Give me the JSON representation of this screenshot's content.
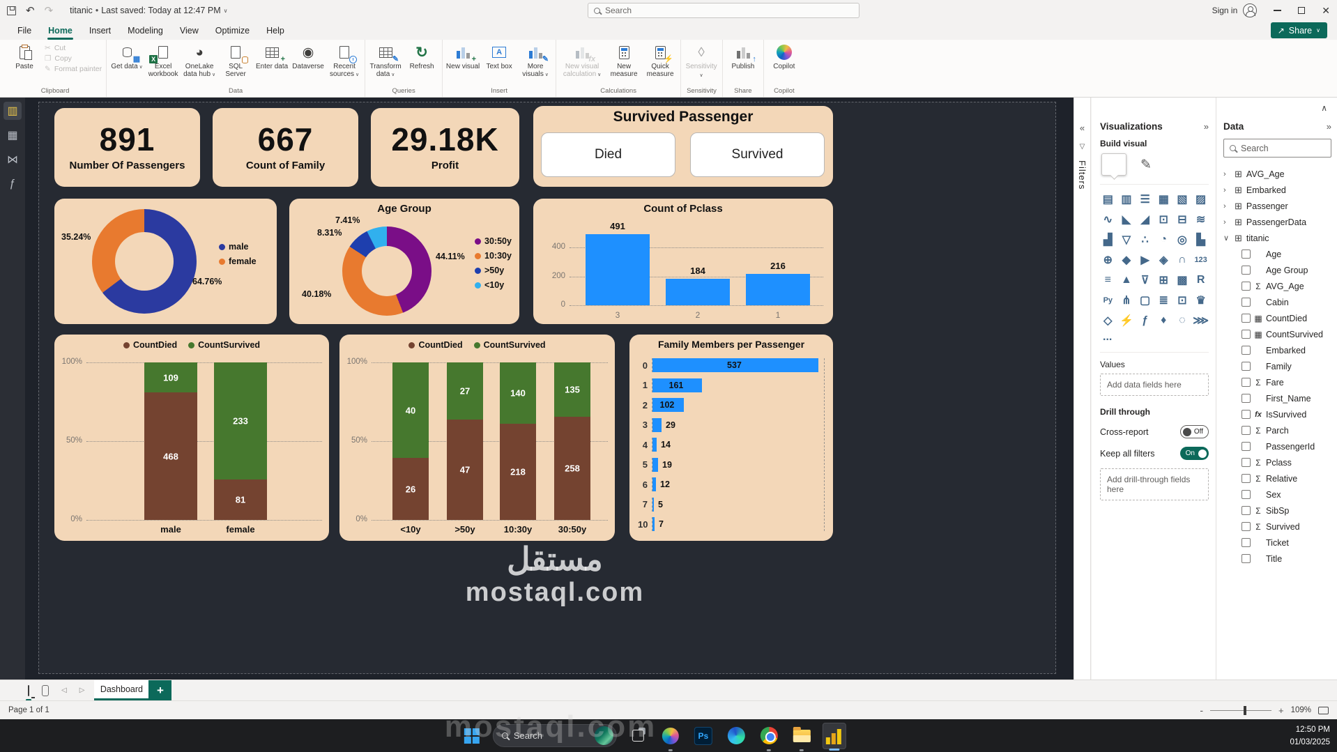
{
  "titlebar": {
    "doc_title": "titanic",
    "autosave_note": "Last saved: Today at 12:47 PM",
    "search_placeholder": "Search",
    "sign_in": "Sign in"
  },
  "menu": {
    "items": [
      "File",
      "Home",
      "Insert",
      "Modeling",
      "View",
      "Optimize",
      "Help"
    ],
    "share_label": "Share"
  },
  "ribbon": {
    "clipboard": {
      "label": "Clipboard",
      "paste": "Paste",
      "cut": "Cut",
      "copy": "Copy",
      "format_painter": "Format painter"
    },
    "data": {
      "label": "Data",
      "get_data": "Get data",
      "excel": "Excel workbook",
      "onelake": "OneLake data hub",
      "sql": "SQL Server",
      "enter": "Enter data",
      "dataverse": "Dataverse",
      "recent": "Recent sources"
    },
    "queries": {
      "label": "Queries",
      "transform": "Transform data",
      "refresh": "Refresh"
    },
    "insert": {
      "label": "Insert",
      "new_visual": "New visual",
      "text_box": "Text box",
      "more_visuals": "More visuals"
    },
    "calculations": {
      "label": "Calculations",
      "new_visual_calc": "New visual calculation",
      "new_measure": "New measure",
      "quick_measure": "Quick measure"
    },
    "sensitivity": {
      "label": "Sensitivity",
      "button": "Sensitivity"
    },
    "share": {
      "label": "Share",
      "publish": "Publish"
    },
    "copilot": {
      "label": "Copilot",
      "button": "Copilot"
    }
  },
  "cards": [
    {
      "value": "891",
      "label": "Number Of Passengers"
    },
    {
      "value": "667",
      "label": "Count of Family"
    },
    {
      "value": "29.18K",
      "label": "Profit"
    }
  ],
  "slicer": {
    "title": "Survived Passenger",
    "options": [
      "Died",
      "Survived"
    ]
  },
  "chart_data": [
    {
      "type": "donut",
      "name": "sex-distribution",
      "legend_position": "right",
      "slices": [
        {
          "label": "male",
          "value_pct": 64.76,
          "display": "64.76%",
          "color": "#2b3aa0"
        },
        {
          "label": "female",
          "value_pct": 35.24,
          "display": "35.24%",
          "color": "#e87a2f"
        }
      ]
    },
    {
      "type": "donut",
      "name": "age-group",
      "title": "Age Group",
      "legend_position": "right",
      "slices": [
        {
          "label": "30:50y",
          "value_pct": 44.11,
          "display": "44.11%",
          "color": "#7a0e87"
        },
        {
          "label": "10:30y",
          "value_pct": 40.18,
          "display": "40.18%",
          "color": "#e87a2f"
        },
        {
          "label": ">50y",
          "value_pct": 8.31,
          "display": "8.31%",
          "color": "#1e3fae"
        },
        {
          "label": "<10y",
          "value_pct": 7.41,
          "display": "7.41%",
          "color": "#31b0ee"
        }
      ]
    },
    {
      "type": "bar",
      "title": "Count of Pclass",
      "categories": [
        "3",
        "2",
        "1"
      ],
      "values": [
        491,
        184,
        216
      ],
      "yticks": [
        400,
        200,
        0
      ],
      "ymax_grid": 400,
      "grid": "dotted",
      "color": "#1e90ff"
    },
    {
      "type": "stacked100",
      "title": "",
      "categories": [
        "male",
        "female"
      ],
      "series": [
        {
          "name": "CountDied",
          "color": "#744330",
          "values": [
            468,
            81
          ]
        },
        {
          "name": "CountSurvived",
          "color": "#46782e",
          "values": [
            109,
            233
          ]
        }
      ],
      "yticks": [
        "100%",
        "50%",
        "0%"
      ],
      "legend_position": "top"
    },
    {
      "type": "stacked100",
      "title": "",
      "categories": [
        "<10y",
        ">50y",
        "10:30y",
        "30:50y"
      ],
      "series": [
        {
          "name": "CountDied",
          "color": "#744330",
          "values": [
            26,
            47,
            218,
            258
          ]
        },
        {
          "name": "CountSurvived",
          "color": "#46782e",
          "values": [
            40,
            27,
            140,
            135
          ]
        }
      ],
      "yticks": [
        "100%",
        "50%",
        "0%"
      ],
      "legend_position": "top"
    },
    {
      "type": "hbar",
      "title": "Family Members per Passenger",
      "categories": [
        "0",
        "1",
        "2",
        "3",
        "4",
        "5",
        "6",
        "7",
        "10"
      ],
      "values": [
        537,
        161,
        102,
        29,
        14,
        19,
        12,
        5,
        7
      ],
      "color": "#1e90ff"
    }
  ],
  "watermark": {
    "arabic": "مستقل",
    "latin": "mostaql.com"
  },
  "filters_panel": {
    "title": "Filters"
  },
  "viz_panel": {
    "title": "Visualizations",
    "build_visual": "Build visual",
    "more": "...",
    "values_label": "Values",
    "values_placeholder": "Add data fields here",
    "drill_label": "Drill through",
    "cross_report": "Cross-report",
    "cross_state": "Off",
    "keep_filters": "Keep all filters",
    "keep_state": "On",
    "drill_placeholder": "Add drill-through fields here",
    "icons": [
      {
        "n": "stacked-bar-chart",
        "g": "▤"
      },
      {
        "n": "stacked-column-chart",
        "g": "▥"
      },
      {
        "n": "clustered-bar-chart",
        "g": "☰"
      },
      {
        "n": "clustered-column-chart",
        "g": "▦"
      },
      {
        "n": "100-stacked-bar-chart",
        "g": "▧"
      },
      {
        "n": "100-stacked-column-chart",
        "g": "▨"
      },
      {
        "n": "line-chart",
        "g": "∿"
      },
      {
        "n": "area-chart",
        "g": "◣"
      },
      {
        "n": "stacked-area-chart",
        "g": "◢"
      },
      {
        "n": "line-and-stacked-column-chart",
        "g": "⊡"
      },
      {
        "n": "line-and-clustered-column-chart",
        "g": "⊟"
      },
      {
        "n": "ribbon-chart",
        "g": "≋"
      },
      {
        "n": "waterfall-chart",
        "g": "▟"
      },
      {
        "n": "funnel-chart",
        "g": "▽"
      },
      {
        "n": "scatter-chart",
        "g": "∴"
      },
      {
        "n": "pie-chart",
        "g": "◔"
      },
      {
        "n": "donut-chart",
        "g": "◎"
      },
      {
        "n": "treemap",
        "g": "▙"
      },
      {
        "n": "map",
        "g": "⊕"
      },
      {
        "n": "filled-map",
        "g": "◆"
      },
      {
        "n": "azure-map",
        "g": "▶"
      },
      {
        "n": "shape-map",
        "g": "◈"
      },
      {
        "n": "gauge",
        "g": "∩"
      },
      {
        "n": "card",
        "g": "123"
      },
      {
        "n": "multi-row-card",
        "g": "≡"
      },
      {
        "n": "kpi",
        "g": "▲"
      },
      {
        "n": "slicer",
        "g": "⊽"
      },
      {
        "n": "table",
        "g": "⊞"
      },
      {
        "n": "matrix",
        "g": "▩"
      },
      {
        "n": "r-script-visual",
        "g": "R"
      },
      {
        "n": "python-visual",
        "g": "Py"
      },
      {
        "n": "decomposition-tree",
        "g": "⋔"
      },
      {
        "n": "qa-visual",
        "g": "▢"
      },
      {
        "n": "smart-narrative",
        "g": "≣"
      },
      {
        "n": "paginated-report",
        "g": "⊡"
      },
      {
        "n": "metrics",
        "g": "♛"
      },
      {
        "n": "power-apps-visual",
        "g": "◇"
      },
      {
        "n": "calculation-group",
        "g": "⚡"
      },
      {
        "n": "dax-query-visual",
        "g": "ƒ"
      },
      {
        "n": "arcgis-map",
        "g": "♦"
      },
      {
        "n": "shape",
        "g": "◌"
      },
      {
        "n": "power-automate-visual",
        "g": "⋙"
      }
    ]
  },
  "data_panel": {
    "title": "Data",
    "search_placeholder": "Search",
    "tables": [
      {
        "name": "AVG_Age",
        "expanded": false
      },
      {
        "name": "Embarked",
        "expanded": false
      },
      {
        "name": "Passenger",
        "expanded": false
      },
      {
        "name": "PassengerData",
        "expanded": false
      },
      {
        "name": "titanic",
        "expanded": true
      }
    ],
    "fields": [
      {
        "name": "Age",
        "icon": ""
      },
      {
        "name": "Age Group",
        "icon": ""
      },
      {
        "name": "AVG_Age",
        "icon": "Σ"
      },
      {
        "name": "Cabin",
        "icon": ""
      },
      {
        "name": "CountDied",
        "icon": "▦"
      },
      {
        "name": "CountSurvived",
        "icon": "▦"
      },
      {
        "name": "Embarked",
        "icon": ""
      },
      {
        "name": "Family",
        "icon": ""
      },
      {
        "name": "Fare",
        "icon": "Σ"
      },
      {
        "name": "First_Name",
        "icon": ""
      },
      {
        "name": "IsSurvived",
        "icon": "fx"
      },
      {
        "name": "Parch",
        "icon": "Σ"
      },
      {
        "name": "PassengerId",
        "icon": ""
      },
      {
        "name": "Pclass",
        "icon": "Σ"
      },
      {
        "name": "Relative",
        "icon": "Σ"
      },
      {
        "name": "Sex",
        "icon": ""
      },
      {
        "name": "SibSp",
        "icon": "Σ"
      },
      {
        "name": "Survived",
        "icon": "Σ"
      },
      {
        "name": "Ticket",
        "icon": ""
      },
      {
        "name": "Title",
        "icon": ""
      }
    ]
  },
  "pages": {
    "tab": "Dashboard",
    "status": "Page 1 of 1",
    "zoom": "109%"
  },
  "taskbar": {
    "search_placeholder": "Search",
    "time": "12:50 PM",
    "date": "01/03/2025"
  }
}
